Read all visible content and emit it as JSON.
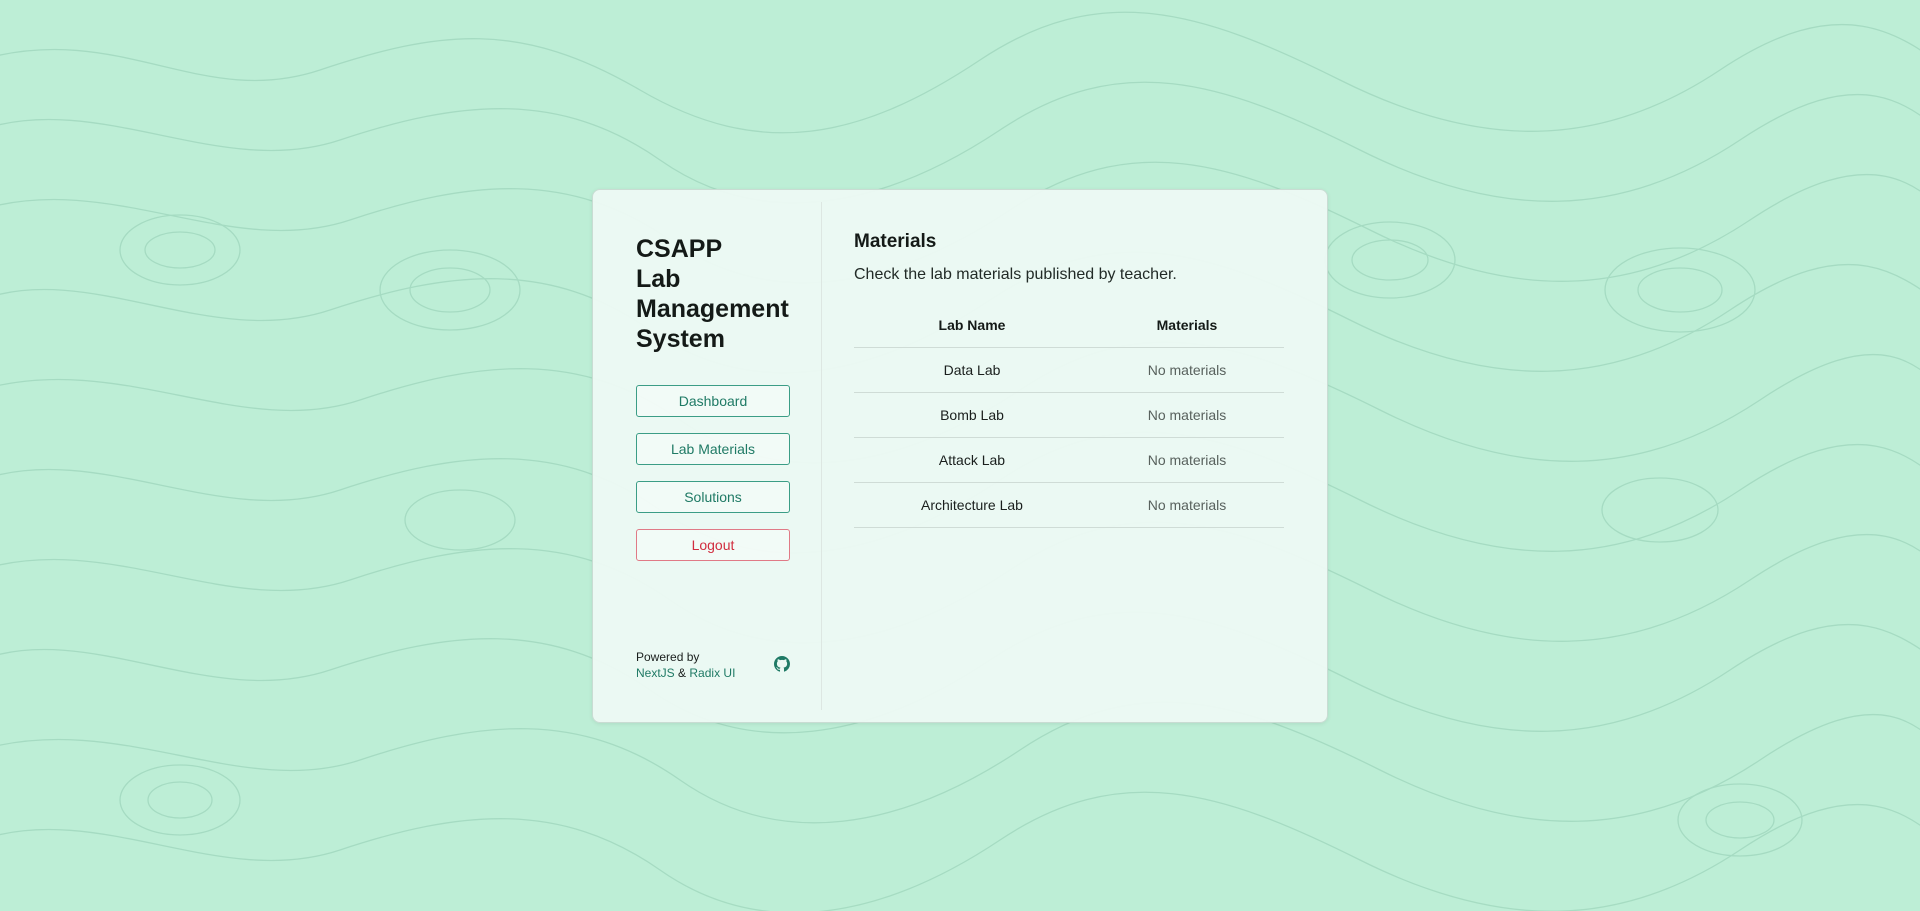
{
  "app": {
    "title_lines": [
      "CSAPP",
      "Lab",
      "Management",
      "System"
    ]
  },
  "nav": {
    "items": [
      {
        "label": "Dashboard"
      },
      {
        "label": "Lab Materials"
      },
      {
        "label": "Solutions"
      },
      {
        "label": "Logout"
      }
    ]
  },
  "footer": {
    "powered_by": "Powered by",
    "link1": "NextJS",
    "amp": "&",
    "link2": "Radix UI",
    "icon": "github-icon"
  },
  "page": {
    "title": "Materials",
    "subtitle": "Check the lab materials published by teacher."
  },
  "table": {
    "headers": [
      "Lab Name",
      "Materials"
    ],
    "rows": [
      {
        "name": "Data Lab",
        "materials": "No materials"
      },
      {
        "name": "Bomb Lab",
        "materials": "No materials"
      },
      {
        "name": "Attack Lab",
        "materials": "No materials"
      },
      {
        "name": "Architecture Lab",
        "materials": "No materials"
      }
    ]
  },
  "colors": {
    "background": "#bdeed6",
    "accent": "#1f7a65",
    "danger": "#d12d3f"
  }
}
